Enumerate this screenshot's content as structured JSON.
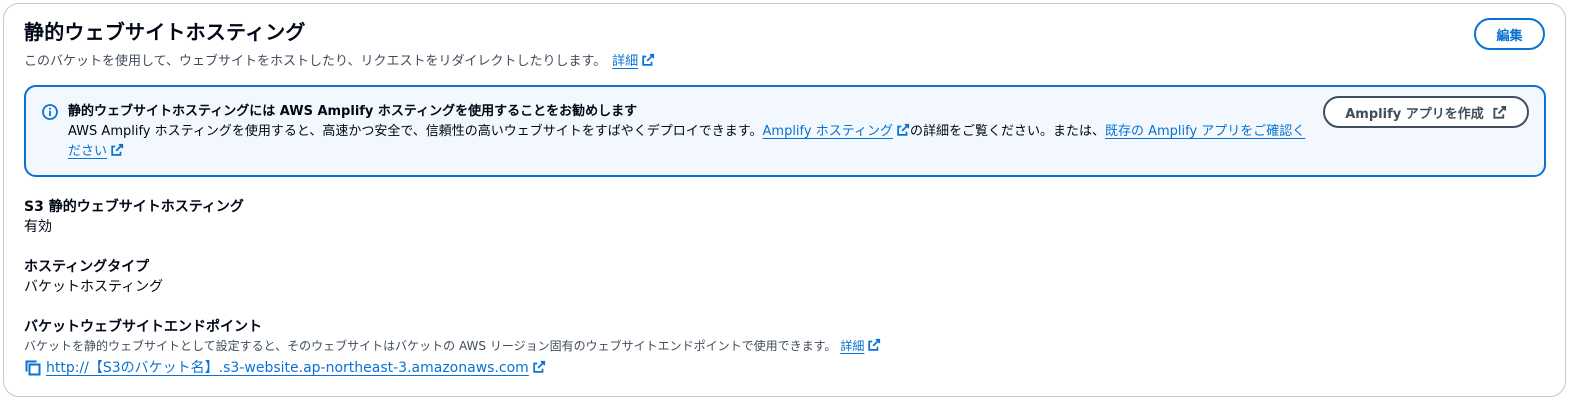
{
  "header": {
    "title": "静的ウェブサイトホスティング",
    "description": "このバケットを使用して、ウェブサイトをホストしたり、リクエストをリダイレクトしたりします。",
    "details_link": "詳細",
    "edit_label": "編集"
  },
  "alert": {
    "title": "静的ウェブサイトホスティングには AWS Amplify ホスティングを使用することをお勧めします",
    "body_pre": "AWS Amplify ホスティングを使用すると、高速かつ安全で、信頼性の高いウェブサイトをすばやくデプロイできます。",
    "amplify_hosting_link": "Amplify ホスティング",
    "body_mid": "の詳細をご覧ください。または、",
    "existing_apps_link": "既存の Amplify アプリをご確認ください",
    "button_label": "Amplify アプリを作成"
  },
  "fields": {
    "hosting": {
      "label": "S3 静的ウェブサイトホスティング",
      "value": "有効"
    },
    "type": {
      "label": "ホスティングタイプ",
      "value": "バケットホスティング"
    },
    "endpoint": {
      "label": "バケットウェブサイトエンドポイント",
      "description": "バケットを静的ウェブサイトとして設定すると、そのウェブサイトはバケットの AWS リージョン固有のウェブサイトエンドポイントで使用できます。",
      "details_link": "詳細",
      "url": "http://【S3のバケット名】.s3-website.ap-northeast-3.amazonaws.com"
    }
  },
  "colors": {
    "link": "#0972d3",
    "alert_bg": "#f2f8fd",
    "text": "#000716",
    "secondary_text": "#414d5c"
  },
  "icons": {
    "external": "external-link-icon",
    "info": "info-icon",
    "copy": "copy-icon"
  }
}
